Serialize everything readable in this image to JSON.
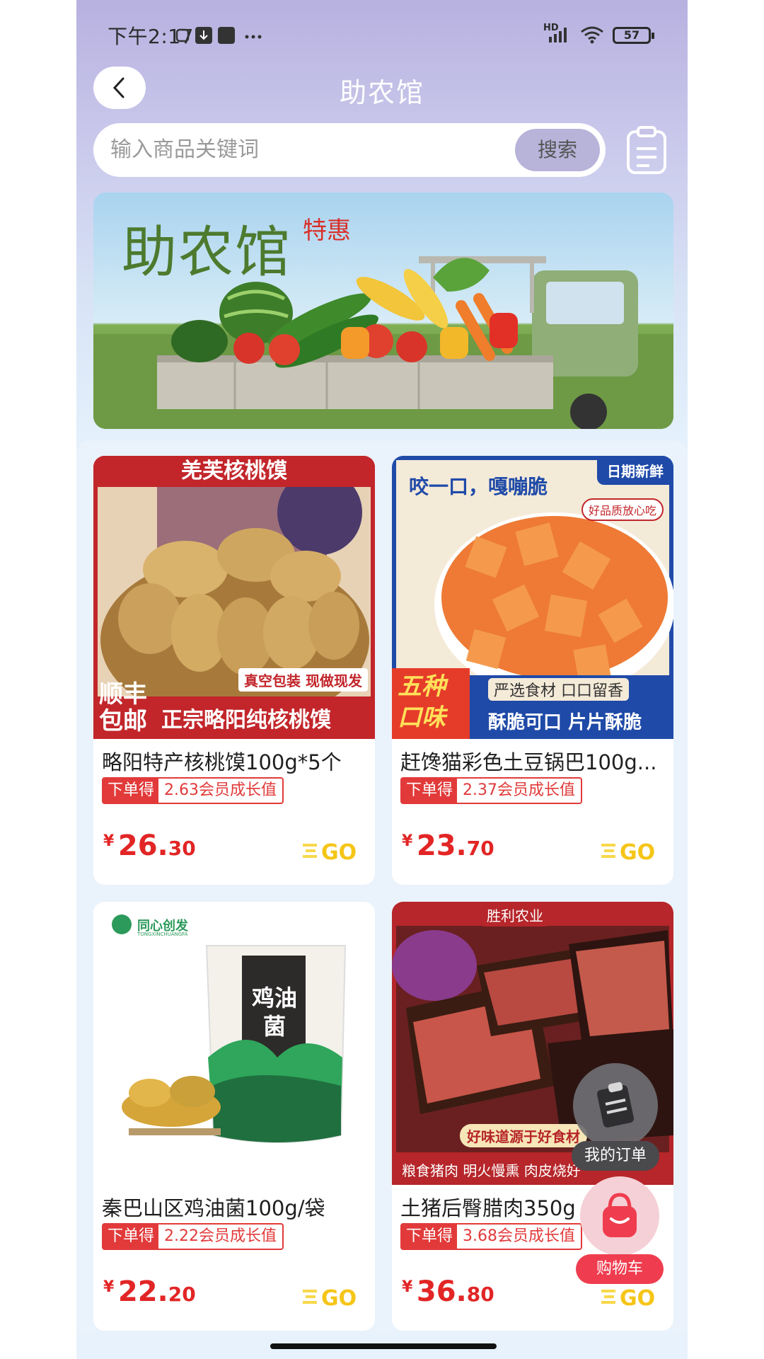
{
  "status_bar": {
    "time": "下午2:17",
    "battery": "57",
    "network": "HD"
  },
  "header": {
    "title": "助农馆",
    "back_label": "<"
  },
  "search": {
    "placeholder": "输入商品关键词",
    "button": "搜索"
  },
  "banner": {
    "title": "助农馆",
    "subtitle": "特惠"
  },
  "products": [
    {
      "name": "略阳特产核桃馍100g*5个",
      "tag_prefix": "下单得",
      "tag_value": "2.63会员成长值",
      "currency": "¥",
      "price_int": "26.",
      "price_dec": "30",
      "img_top": "羌芙核桃馍",
      "img_badge": "真空包装 现做现发",
      "img_left": "顺丰包邮",
      "img_bottom": "正宗略阳纯核桃馍"
    },
    {
      "name": "赶馋猫彩色土豆锅巴100g...",
      "tag_prefix": "下单得",
      "tag_value": "2.37会员成长值",
      "currency": "¥",
      "price_int": "23.",
      "price_dec": "70",
      "img_top_right": "日期新鲜",
      "img_headline": "咬一口，嘎嘣脆",
      "img_stamp": "好品质放心吃",
      "img_left": "五种口味",
      "img_line1": "严选食材 口口留香",
      "img_line2": "酥脆可口 片片酥脆"
    },
    {
      "name": "秦巴山区鸡油菌100g/袋",
      "tag_prefix": "下单得",
      "tag_value": "2.22会员成长值",
      "currency": "¥",
      "price_int": "22.",
      "price_dec": "20",
      "img_brand": "同心创发",
      "img_brand_en": "TONGXINCHUANGFA",
      "img_bag_label": "鸡油菌"
    },
    {
      "name": "土猪后臀腊肉350g",
      "tag_prefix": "下单得",
      "tag_value": "3.68会员成长值",
      "currency": "¥",
      "price_int": "36.",
      "price_dec": "80",
      "img_top": "胜利农业",
      "img_ribbon": "好味道源于好食材",
      "img_bottom": "粮食猪肉 明火慢熏 肉皮烧好"
    }
  ],
  "floating": {
    "orders_label": "我的订单",
    "cart_label": "购物车"
  },
  "colors": {
    "price": "#e22525",
    "accent": "#b7b3d9",
    "cart": "#ef3d4f"
  }
}
